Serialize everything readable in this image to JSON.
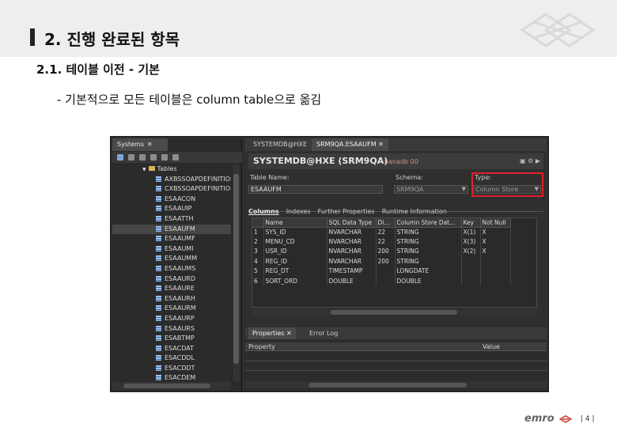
{
  "slide": {
    "title": "2. 진행 완료된 항목",
    "subtitle": "2.1. 테이블 이전 - 기본",
    "bullet": "- 기본적으로 모든 테이블은 column table으로 옮김",
    "footer_logo": "emro",
    "page_number": "| 4 |"
  },
  "systems_panel": {
    "tab_label": "Systems",
    "close_glyph": "✕",
    "tables_node": "Tables",
    "tables": [
      "AXBSSOAPDEFINITION",
      "CXBSSOAPDEFINITION",
      "ESAACON",
      "ESAAUIP",
      "ESAATTH",
      "ESAAUFM",
      "ESAAUMF",
      "ESAAUMI",
      "ESAAUMM",
      "ESAAUMS",
      "ESAAURD",
      "ESAAURE",
      "ESAAURH",
      "ESAAURM",
      "ESAAURP",
      "ESAAURS",
      "ESABTMP",
      "ESACDAT",
      "ESACDDL",
      "ESACDDT",
      "ESACDEM"
    ],
    "selected_index": 5
  },
  "editor": {
    "tabs": [
      "SYSTEMDB@HXE",
      "SRM9QA.ESAAUFM"
    ],
    "close_glyph": "✕",
    "header_title": "SYSTEMDB@HXE (SRM9QA)",
    "host": "hanadb 00",
    "table_name_label": "Table Name:",
    "table_name_value": "ESAAUFM",
    "schema_label": "Schema:",
    "schema_value": "SRM9QA",
    "type_label": "Type:",
    "type_value": "Column Store",
    "sub_tabs": [
      "Columns",
      "Indexes",
      "Further Properties",
      "Runtime Information"
    ],
    "columns_header": [
      "",
      "Name",
      "SQL Data Type",
      "Di...",
      "Column Store Dat...",
      "Key",
      "Not Null"
    ],
    "rows": [
      [
        "1",
        "SYS_ID",
        "NVARCHAR",
        "22",
        "STRING",
        "X(1)",
        "X"
      ],
      [
        "2",
        "MENU_CD",
        "NVARCHAR",
        "22",
        "STRING",
        "X(3)",
        "X"
      ],
      [
        "3",
        "USR_ID",
        "NVARCHAR",
        "200",
        "STRING",
        "X(2)",
        "X"
      ],
      [
        "4",
        "REG_ID",
        "NVARCHAR",
        "200",
        "STRING",
        "",
        ""
      ],
      [
        "5",
        "REG_DT",
        "TIMESTAMP",
        "",
        "LONGDATE",
        "",
        ""
      ],
      [
        "6",
        "SORT_ORD",
        "DOUBLE",
        "",
        "DOUBLE",
        "",
        ""
      ]
    ]
  },
  "properties_panel": {
    "tabs": [
      "Properties",
      "Error Log"
    ],
    "column_property": "Property",
    "column_value": "Value"
  },
  "colors": {
    "highlight": "#e0202a",
    "ide_background": "#2e2e2e"
  }
}
